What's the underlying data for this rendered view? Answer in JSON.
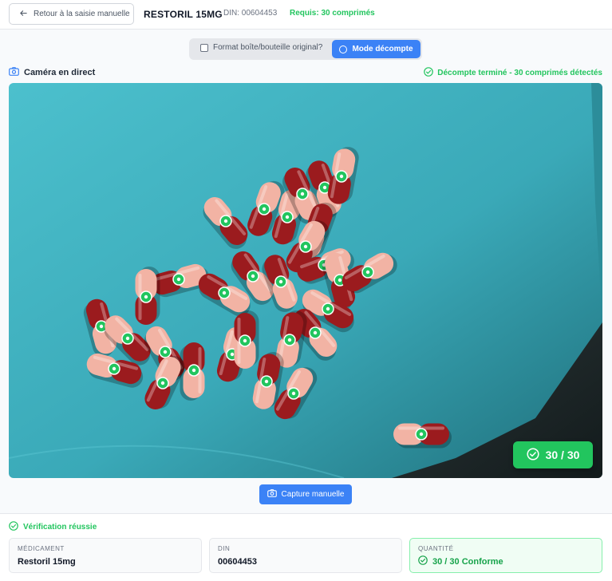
{
  "header": {
    "back_label": "Retour à la saisie manuelle",
    "title": "RESTORIL 15MG",
    "din": "DIN: 00604453",
    "required": "Requis: 30 comprimés"
  },
  "toolbar": {
    "checkbox_label": "Format boîte/bouteille original?",
    "checkbox_checked": false,
    "mode_label": "Mode décompte"
  },
  "camera": {
    "label": "Caméra en direct",
    "status": "Décompte terminé - 30 comprimés détectés",
    "counter": "30 / 30",
    "detected_count": 30
  },
  "capture_label": "Capture manuelle",
  "footer": {
    "verification": "Vérification réussie",
    "cards": [
      {
        "label": "MÉDICAMENT",
        "value": "Restoril 15mg"
      },
      {
        "label": "DIN",
        "value": "00604453"
      },
      {
        "label": "QUANTITÉ",
        "value": "30 / 30 Conforme"
      }
    ]
  },
  "colors": {
    "accent": "#3b82f6",
    "success": "#22c55e",
    "tray": "#3fb2c1",
    "capsule_dark": "#9b1b1e",
    "capsule_light": "#f2b3a4"
  }
}
